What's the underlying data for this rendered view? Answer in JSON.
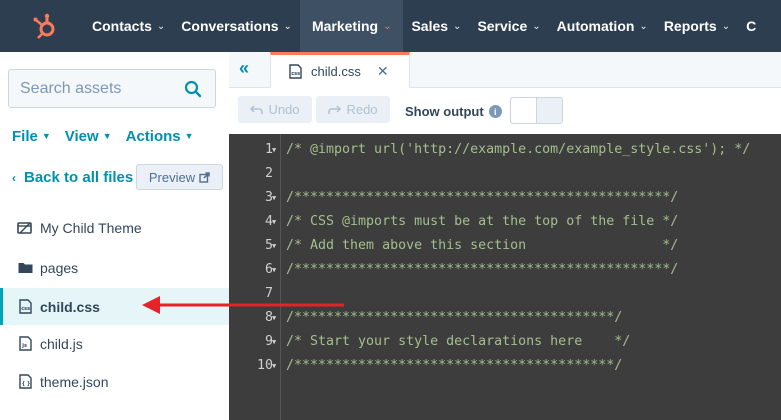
{
  "nav": {
    "logo_icon": "hubspot-sprocket-icon",
    "items": [
      {
        "label": "Contacts"
      },
      {
        "label": "Conversations"
      },
      {
        "label": "Marketing"
      },
      {
        "label": "Sales"
      },
      {
        "label": "Service"
      },
      {
        "label": "Automation"
      },
      {
        "label": "Reports"
      },
      {
        "label": "C"
      }
    ],
    "active": "Marketing",
    "accent": "#ff7a59"
  },
  "sidebar": {
    "search_placeholder": "Search assets",
    "menus": [
      {
        "label": "File"
      },
      {
        "label": "View"
      },
      {
        "label": "Actions"
      }
    ],
    "back_label": "Back to all files",
    "preview_label": "Preview",
    "files": [
      {
        "label": "My Child Theme",
        "icon": "theme-icon"
      },
      {
        "label": "pages",
        "icon": "folder-icon"
      },
      {
        "label": "child.css",
        "icon": "css-file-icon",
        "selected": true
      },
      {
        "label": "child.js",
        "icon": "js-file-icon"
      },
      {
        "label": "theme.json",
        "icon": "json-file-icon"
      }
    ]
  },
  "editor": {
    "tab_name": "child.css",
    "undo_label": "Undo",
    "redo_label": "Redo",
    "show_output_label": "Show output",
    "lines": [
      {
        "n": "1",
        "text": "/* @import url('http://example.com/example_style.css'); */"
      },
      {
        "n": "2",
        "text": ""
      },
      {
        "n": "3",
        "text": "/***********************************************/"
      },
      {
        "n": "4",
        "text": "/* CSS @imports must be at the top of the file */"
      },
      {
        "n": "5",
        "text": "/* Add them above this section                 */"
      },
      {
        "n": "6",
        "text": "/***********************************************/"
      },
      {
        "n": "7",
        "text": ""
      },
      {
        "n": "8",
        "text": "/****************************************/"
      },
      {
        "n": "9",
        "text": "/* Start your style declarations here    */"
      },
      {
        "n": "10",
        "text": "/****************************************/"
      }
    ]
  }
}
